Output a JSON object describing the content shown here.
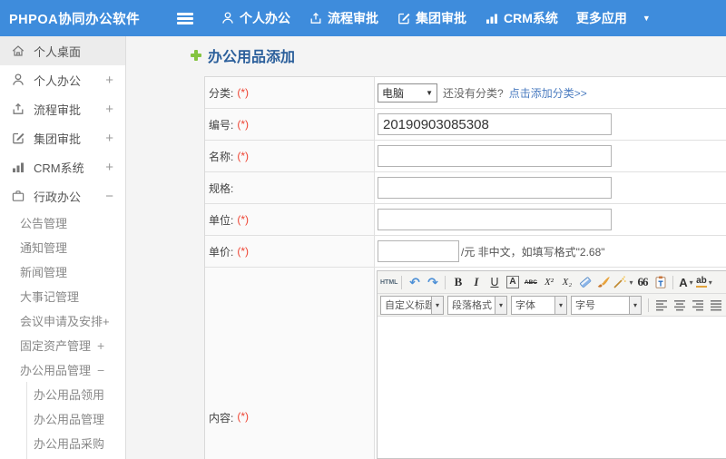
{
  "topbar": {
    "logo": "PHPOA协同办公软件",
    "nav": [
      {
        "label": "个人办公"
      },
      {
        "label": "流程审批"
      },
      {
        "label": "集团审批"
      },
      {
        "label": "CRM系统"
      },
      {
        "label": "更多应用"
      }
    ]
  },
  "sidebar": {
    "items": [
      {
        "label": "个人桌面",
        "level": 1,
        "active": true
      },
      {
        "label": "个人办公",
        "level": 1,
        "expander": "+"
      },
      {
        "label": "流程审批",
        "level": 1,
        "expander": "+"
      },
      {
        "label": "集团审批",
        "level": 1,
        "expander": "+"
      },
      {
        "label": "CRM系统",
        "level": 1,
        "expander": "+"
      },
      {
        "label": "行政办公",
        "level": 1,
        "expander": "−"
      },
      {
        "label": "公告管理",
        "level": 2
      },
      {
        "label": "通知管理",
        "level": 2
      },
      {
        "label": "新闻管理",
        "level": 2
      },
      {
        "label": "大事记管理",
        "level": 2
      },
      {
        "label": "会议申请及安排+",
        "level": 2
      },
      {
        "label": "固定资产管理",
        "level": 2,
        "expander": "+"
      },
      {
        "label": "办公用品管理",
        "level": 2,
        "expander": "−"
      },
      {
        "label": "办公用品领用",
        "level": 3
      },
      {
        "label": "办公用品管理",
        "level": 3
      },
      {
        "label": "办公用品采购",
        "level": 3
      }
    ]
  },
  "main": {
    "title": "办公用品添加",
    "form": {
      "category": {
        "label": "分类:",
        "required": "(*)",
        "select_value": "电脑",
        "hint": "还没有分类?",
        "link": "点击添加分类>>"
      },
      "code": {
        "label": "编号:",
        "required": "(*)",
        "value": "20190903085308"
      },
      "name": {
        "label": "名称:",
        "required": "(*)",
        "value": ""
      },
      "spec": {
        "label": "规格:",
        "value": ""
      },
      "unit": {
        "label": "单位:",
        "required": "(*)",
        "value": ""
      },
      "price": {
        "label": "单价:",
        "required": "(*)",
        "value": "",
        "suffix": "/元 非中文，如填写格式\"2.68\""
      },
      "content": {
        "label": "内容:",
        "required": "(*)"
      }
    },
    "editor": {
      "html_button": "HTML",
      "undo": "↶",
      "redo": "↷",
      "bold": "B",
      "italic": "I",
      "underline": "U",
      "font_box": "A",
      "strike": "ABC",
      "superscript": "X²",
      "subscript": "X₂",
      "quote": "66",
      "font_color": "A",
      "highlight": "ab",
      "selects": [
        {
          "label": "自定义标题"
        },
        {
          "label": "段落格式"
        },
        {
          "label": "字体"
        },
        {
          "label": "字号"
        }
      ]
    }
  },
  "icons": {
    "caret_down": "▼",
    "caret_small": "▾",
    "link_chain": "∞"
  },
  "colors": {
    "topbar_blue": "#3e8cdc",
    "title_blue": "#2b5f9b",
    "link_blue": "#4b7cc0",
    "required_red": "#ee4433",
    "plus_green": "#85c440"
  }
}
